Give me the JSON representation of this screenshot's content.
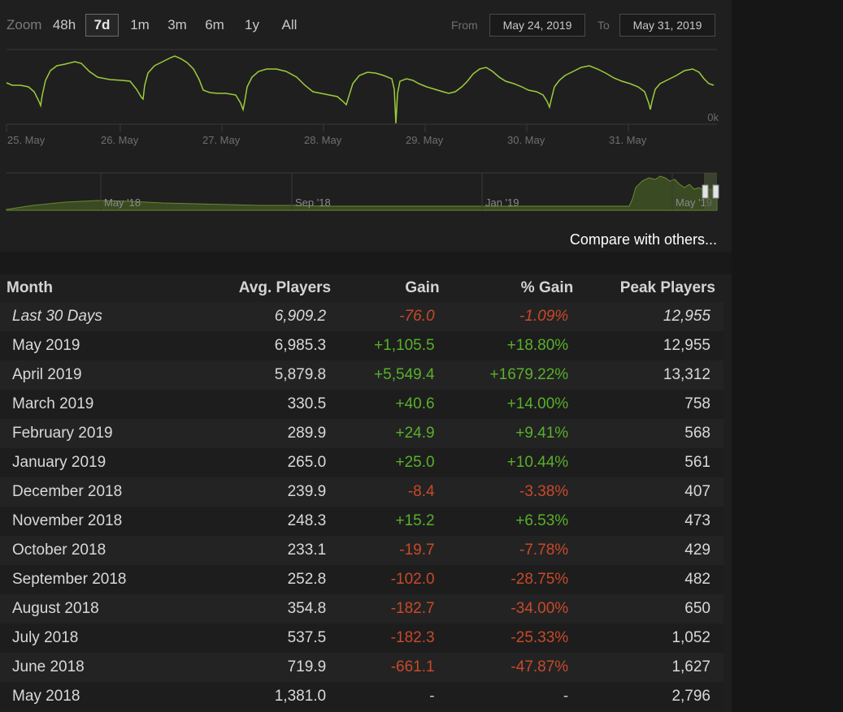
{
  "zoom": {
    "label": "Zoom",
    "options": [
      "48h",
      "7d",
      "1m",
      "3m",
      "6m",
      "1y",
      "All"
    ],
    "selected": "7d"
  },
  "range": {
    "from_label": "From",
    "from_value": "May 24, 2019",
    "to_label": "To",
    "to_value": "May 31, 2019"
  },
  "chart_data": {
    "type": "line",
    "title": "",
    "xlabel": "",
    "ylabel": "",
    "x_ticks": [
      "25. May",
      "26. May",
      "27. May",
      "28. May",
      "29. May",
      "30. May",
      "31. May"
    ],
    "y_ticks": [
      "0k"
    ],
    "series_color": "#9ccc3c",
    "navigator_ticks": [
      "May '18",
      "Sep '18",
      "Jan '19",
      "May '19"
    ]
  },
  "compare_link": "Compare with others...",
  "table": {
    "headers": {
      "month": "Month",
      "avg": "Avg. Players",
      "gain": "Gain",
      "pct": "% Gain",
      "peak": "Peak Players"
    },
    "rows": [
      {
        "month": "Last 30 Days",
        "avg": "6,909.2",
        "gain": "-76.0",
        "pct": "-1.09%",
        "peak": "12,955"
      },
      {
        "month": "May 2019",
        "avg": "6,985.3",
        "gain": "+1,105.5",
        "pct": "+18.80%",
        "peak": "12,955"
      },
      {
        "month": "April 2019",
        "avg": "5,879.8",
        "gain": "+5,549.4",
        "pct": "+1679.22%",
        "peak": "13,312"
      },
      {
        "month": "March 2019",
        "avg": "330.5",
        "gain": "+40.6",
        "pct": "+14.00%",
        "peak": "758"
      },
      {
        "month": "February 2019",
        "avg": "289.9",
        "gain": "+24.9",
        "pct": "+9.41%",
        "peak": "568"
      },
      {
        "month": "January 2019",
        "avg": "265.0",
        "gain": "+25.0",
        "pct": "+10.44%",
        "peak": "561"
      },
      {
        "month": "December 2018",
        "avg": "239.9",
        "gain": "-8.4",
        "pct": "-3.38%",
        "peak": "407"
      },
      {
        "month": "November 2018",
        "avg": "248.3",
        "gain": "+15.2",
        "pct": "+6.53%",
        "peak": "473"
      },
      {
        "month": "October 2018",
        "avg": "233.1",
        "gain": "-19.7",
        "pct": "-7.78%",
        "peak": "429"
      },
      {
        "month": "September 2018",
        "avg": "252.8",
        "gain": "-102.0",
        "pct": "-28.75%",
        "peak": "482"
      },
      {
        "month": "August 2018",
        "avg": "354.8",
        "gain": "-182.7",
        "pct": "-34.00%",
        "peak": "650"
      },
      {
        "month": "July 2018",
        "avg": "537.5",
        "gain": "-182.3",
        "pct": "-25.33%",
        "peak": "1,052"
      },
      {
        "month": "June 2018",
        "avg": "719.9",
        "gain": "-661.1",
        "pct": "-47.87%",
        "peak": "1,627"
      },
      {
        "month": "May 2018",
        "avg": "1,381.0",
        "gain": "-",
        "pct": "-",
        "peak": "2,796"
      }
    ]
  }
}
